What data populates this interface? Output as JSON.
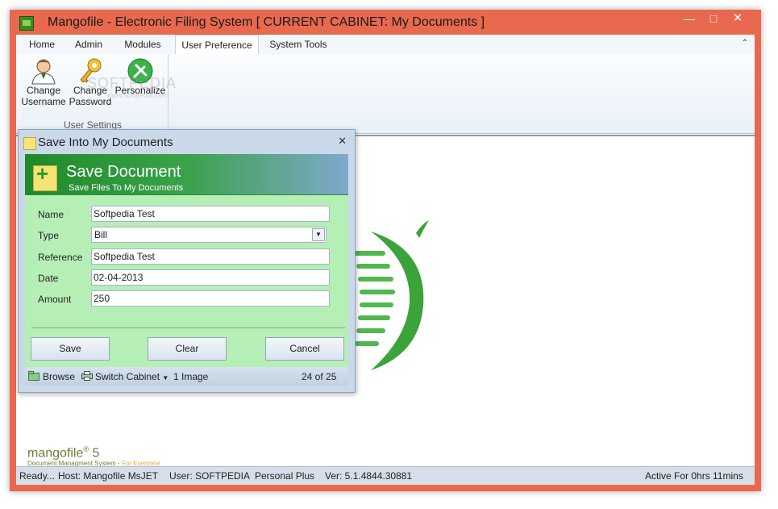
{
  "window": {
    "title": "Mangofile - Electronic Filing System  [ CURRENT CABINET: My Documents ]",
    "controls": {
      "minimize": "—",
      "maximize": "□",
      "close": "✕"
    }
  },
  "ribbon": {
    "tabs": [
      {
        "label": "Home"
      },
      {
        "label": "Admin"
      },
      {
        "label": "Modules"
      },
      {
        "label": "User Preference",
        "active": true
      },
      {
        "label": "System Tools"
      }
    ],
    "collapse_icon": "⌃",
    "group": {
      "label": "User Settings",
      "buttons": [
        {
          "line1": "Change",
          "line2": "Username",
          "icon": "user-icon"
        },
        {
          "line1": "Change",
          "line2": "Password",
          "icon": "key-icon"
        },
        {
          "line1": "Personalize",
          "line2": "",
          "icon": "tools-icon"
        }
      ]
    },
    "watermark": "SOFTPEDIA",
    "watermark_sub": "www.softpedia.com"
  },
  "dialog": {
    "title": "Save Into My Documents",
    "close": "✕",
    "header_title": "Save Document",
    "header_subtitle": "Save Files To My Documents",
    "fields": {
      "name": {
        "label": "Name",
        "value": "Softpedia Test"
      },
      "type": {
        "label": "Type",
        "value": "Bill"
      },
      "reference": {
        "label": "Reference",
        "value": "Softpedia Test"
      },
      "date": {
        "label": "Date",
        "value": "02-04-2013"
      },
      "amount": {
        "label": "Amount",
        "value": "250"
      }
    },
    "buttons": {
      "save": "Save",
      "clear": "Clear",
      "cancel": "Cancel"
    },
    "footer": {
      "browse": "Browse",
      "switch_cabinet": "Switch Cabinet",
      "image_count": "1 Image",
      "page": "24 of 25"
    }
  },
  "branding": {
    "name": "mangofile",
    "reg": "®",
    "version": "5",
    "subtitle": "Document Managment System - ",
    "subtitle_accent": "For Everyone"
  },
  "status": {
    "ready": "Ready...",
    "host": "Host: Mangofile MsJET",
    "user": "User: SOFTPEDIA",
    "edition": "Personal Plus",
    "version": "Ver: 5.1.4844.30881",
    "active": "Active For 0hrs 11mins"
  },
  "colors": {
    "frame": "#e8694e",
    "dialog_body": "#b6efb6",
    "header_green": "#1f8a2a"
  }
}
